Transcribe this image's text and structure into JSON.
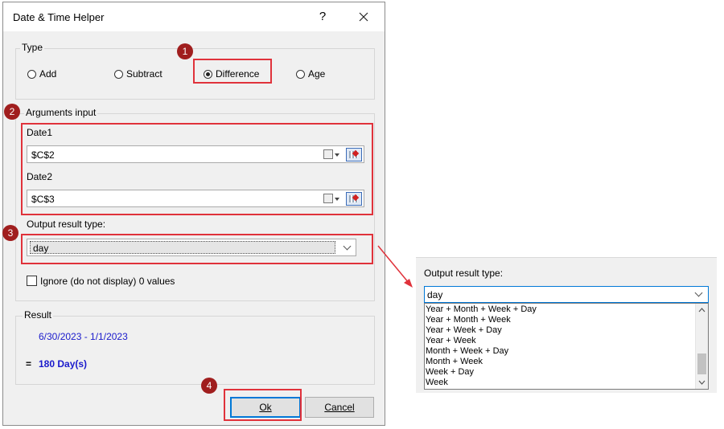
{
  "dialog": {
    "title": "Date & Time Helper",
    "help_label": "?",
    "type_group": {
      "label": "Type",
      "options": [
        {
          "label": "Add",
          "checked": false
        },
        {
          "label": "Subtract",
          "checked": false
        },
        {
          "label": "Difference",
          "checked": true
        },
        {
          "label": "Age",
          "checked": false
        }
      ]
    },
    "arguments_group": {
      "label": "Arguments input",
      "date1_label": "Date1",
      "date1_value": "$C$2",
      "date2_label": "Date2",
      "date2_value": "$C$3",
      "output_label": "Output result type:",
      "output_value": "day",
      "ignore_label": "Ignore (do not display) 0 values"
    },
    "result_group": {
      "label": "Result",
      "dates": "6/30/2023 - 1/1/2023",
      "equals": "=",
      "value": "180 Day(s)"
    },
    "buttons": {
      "ok_label": "Ok",
      "cancel_label": "Cancel"
    }
  },
  "annotations": {
    "badges": [
      "1",
      "2",
      "3",
      "4"
    ]
  },
  "dropdown_panel": {
    "label": "Output result type:",
    "selected": "day",
    "items": [
      "Year + Month + Week + Day",
      "Year + Month + Week",
      "Year + Week + Day",
      "Year + Week",
      "Month + Week + Day",
      "Month + Week",
      "Week + Day",
      "Week"
    ]
  },
  "colors": {
    "highlight": "#e0323b",
    "badge": "#a01e1e",
    "result_text": "#1a1acc",
    "focus": "#0078d7"
  }
}
